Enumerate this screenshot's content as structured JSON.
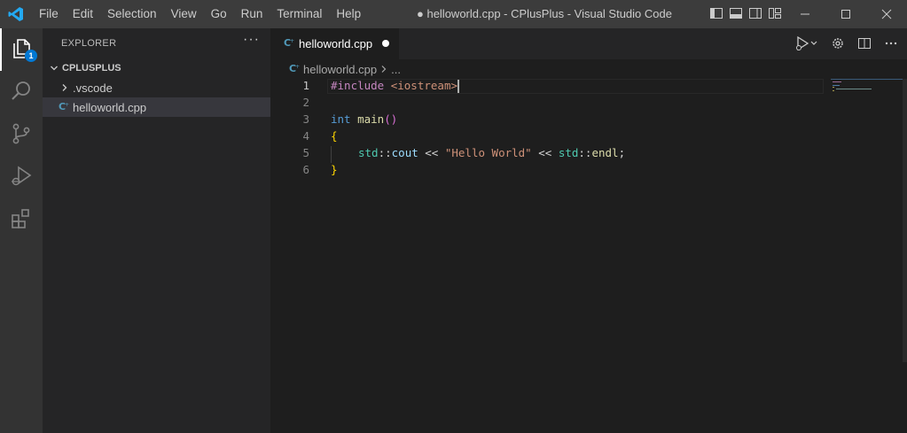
{
  "titlebar": {
    "menu": [
      "File",
      "Edit",
      "Selection",
      "View",
      "Go",
      "Run",
      "Terminal",
      "Help"
    ],
    "window_title": "● helloworld.cpp - CPlusPlus - Visual Studio Code",
    "accent_color": "#0078d4"
  },
  "activity_bar": {
    "explorer_badge": "1",
    "icons": [
      "files-icon",
      "search-icon",
      "source-control-icon",
      "run-debug-icon",
      "extensions-icon"
    ]
  },
  "sidebar": {
    "header": "EXPLORER",
    "more": "···",
    "folder": "CPLUSPLUS",
    "items": [
      {
        "label": ".vscode",
        "type": "folder"
      },
      {
        "label": "helloworld.cpp",
        "type": "cpp-file",
        "selected": true
      }
    ]
  },
  "editor": {
    "tab_label": "helloworld.cpp",
    "breadcrumb_file": "helloworld.cpp",
    "breadcrumb_more": "...",
    "line_numbers": [
      "1",
      "2",
      "3",
      "4",
      "5",
      "6"
    ],
    "code": {
      "line1_directive": "#include ",
      "line1_header": "<iostream>",
      "line3_type": "int",
      "line3_fn": " main",
      "line3_parens": "()",
      "line4_brace": "{",
      "line5_ns1": "std",
      "line5_sep1": "::",
      "line5_var": "cout",
      "line5_op1": " << ",
      "line5_str": "\"Hello World\"",
      "line5_op2": " << ",
      "line5_ns2": "std",
      "line5_sep2": "::",
      "line5_fn": "endl",
      "line5_semi": ";",
      "line6_brace": "}"
    }
  }
}
